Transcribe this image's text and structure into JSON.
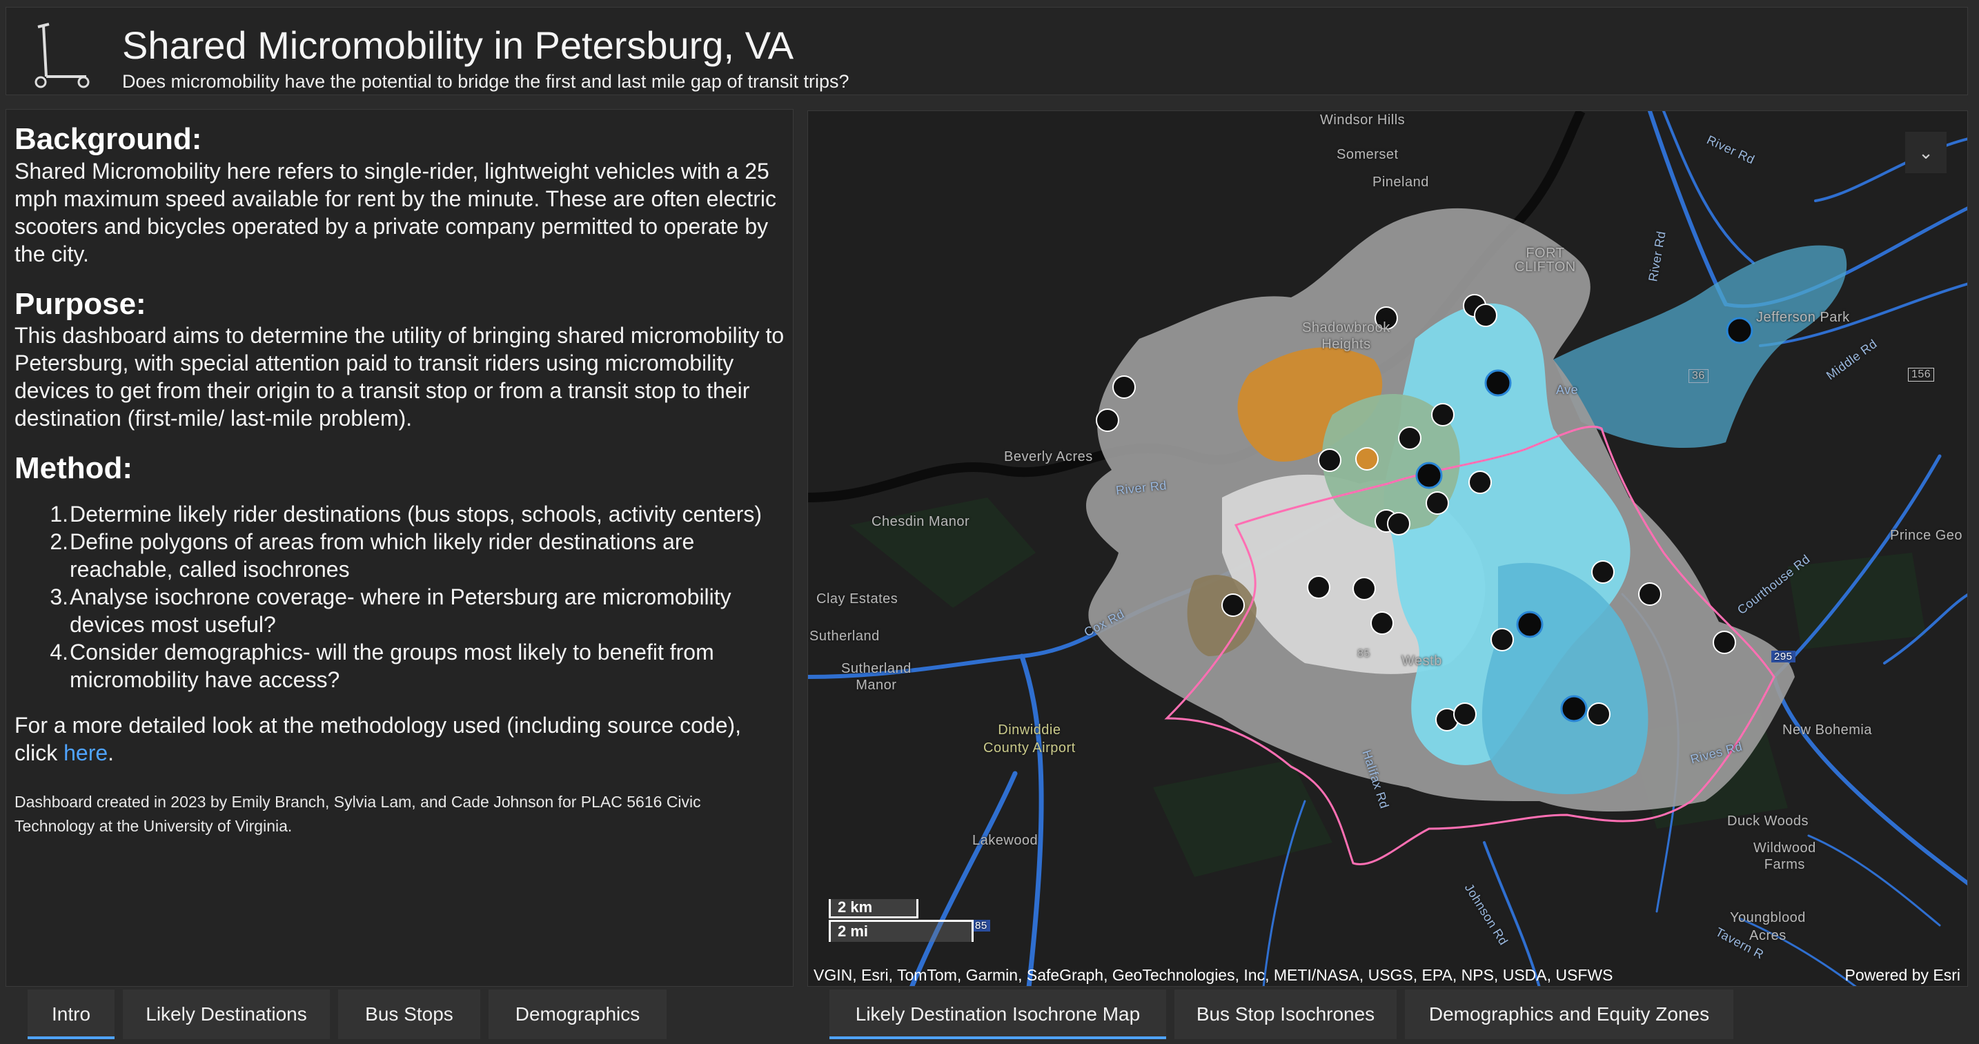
{
  "header": {
    "title": "Shared Micromobility in Petersburg, VA",
    "subtitle": "Does micromobility have the potential to bridge the first and last mile gap of transit trips?",
    "logo_icon": "scooter-icon"
  },
  "intro": {
    "background_heading": "Background:",
    "background_text": "Shared Micromobility here refers to single-rider, lightweight vehicles with a 25 mph maximum speed available for rent by the minute.  These are often electric scooters and bicycles operated by a private company permitted to operate by the city.",
    "purpose_heading": "Purpose:",
    "purpose_text": "This dashboard aims to determine the utility of bringing shared micromobility to Petersburg, with special attention paid to transit riders using micromobility devices to get from their origin to a transit stop or from a transit stop to their destination (first-mile/ last-mile problem).",
    "method_heading": "Method:",
    "method_steps": [
      "Determine likely rider destinations (bus stops, schools, activity centers)",
      "Define polygons of areas from which likely rider destinations are reachable, called isochrones",
      "Analyse isochrone coverage- where in Petersburg are micromobility devices most useful?",
      "Consider demographics- will the groups most likely to benefit from micromobility have access?"
    ],
    "detail_text": "For a more detailed look at the methodology used (including source code), click ",
    "detail_link": "here",
    "detail_end": ".",
    "credit": "Dashboard created in 2023 by Emily Branch, Sylvia Lam, and Cade Johnson for PLAC 5616 Civic Technology at the University of Virginia."
  },
  "map": {
    "labels": {
      "windsor_hills": "Windsor Hills",
      "somerset": "Somerset",
      "pineland": "Pineland",
      "fort_clifton": "FORT\nCLIFTON",
      "shadowbrook": "Shadowbrook\nHeights",
      "jefferson_park": "Jefferson Park",
      "beverly_acres": "Beverly Acres",
      "chesdin_manor": "Chesdin Manor",
      "clay_estates": "Clay Estates",
      "sutherland": "Sutherland",
      "sutherland_manor": "Sutherland\nManor",
      "dinwiddie_airport": "Dinwiddie\nCounty Airport",
      "lakewood": "Lakewood",
      "prince_george": "Prince Geo",
      "new_bohemia": "New Bohemia",
      "duck_woods": "Duck Woods",
      "wildwood_farms": "Wildwood\nFarms",
      "youngblood_acres": "Youngblood\nAcres",
      "westbrook": "Westb",
      "river_rd_1": "River Rd",
      "river_rd_2": "River Rd",
      "river_rd_3": "River Rd",
      "cox_rd": "Cox Rd",
      "halifax_rd": "Halifax Rd",
      "johnson_rd": "Johnson Rd",
      "middle_rd": "Middle Rd",
      "rives_rd": "Rives Rd",
      "courthouse_rd": "Courthouse Rd",
      "tavern_rd": "Tavern R",
      "ave": "Ave",
      "route_36": "36",
      "route_156": "156",
      "route_85": "85",
      "route_295": "295",
      "i85": "85"
    },
    "scale_km": "2 km",
    "scale_mi": "2 mi",
    "attribution": "VGIN, Esri, TomTom, Garmin, SafeGraph, GeoTechnologies, Inc, METI/NASA, USGS, EPA, NPS, USDA, USFWS",
    "powered_by": "Powered by Esri",
    "collapse_icon": "chevron-down-icon",
    "colors": {
      "background": "#1f1f1f",
      "isochrone_cyan": "#7fd8ea",
      "isochrone_blue": "#5bb8d6",
      "isochrone_gray": "#9a9a9a",
      "isochrone_light": "#d6d6d6",
      "isochrone_orange": "#d08b2e",
      "isochrone_green": "#8fb89a",
      "city_boundary": "#ff6fb3",
      "roads": "#2f6fd0"
    }
  },
  "tabs_left": [
    {
      "label": "Intro",
      "active": true
    },
    {
      "label": "Likely Destinations",
      "active": false
    },
    {
      "label": "Bus Stops",
      "active": false
    },
    {
      "label": "Demographics",
      "active": false
    }
  ],
  "tabs_right": [
    {
      "label": "Likely Destination Isochrone Map",
      "active": true
    },
    {
      "label": "Bus Stop Isochrones",
      "active": false
    },
    {
      "label": "Demographics and Equity Zones",
      "active": false
    }
  ]
}
